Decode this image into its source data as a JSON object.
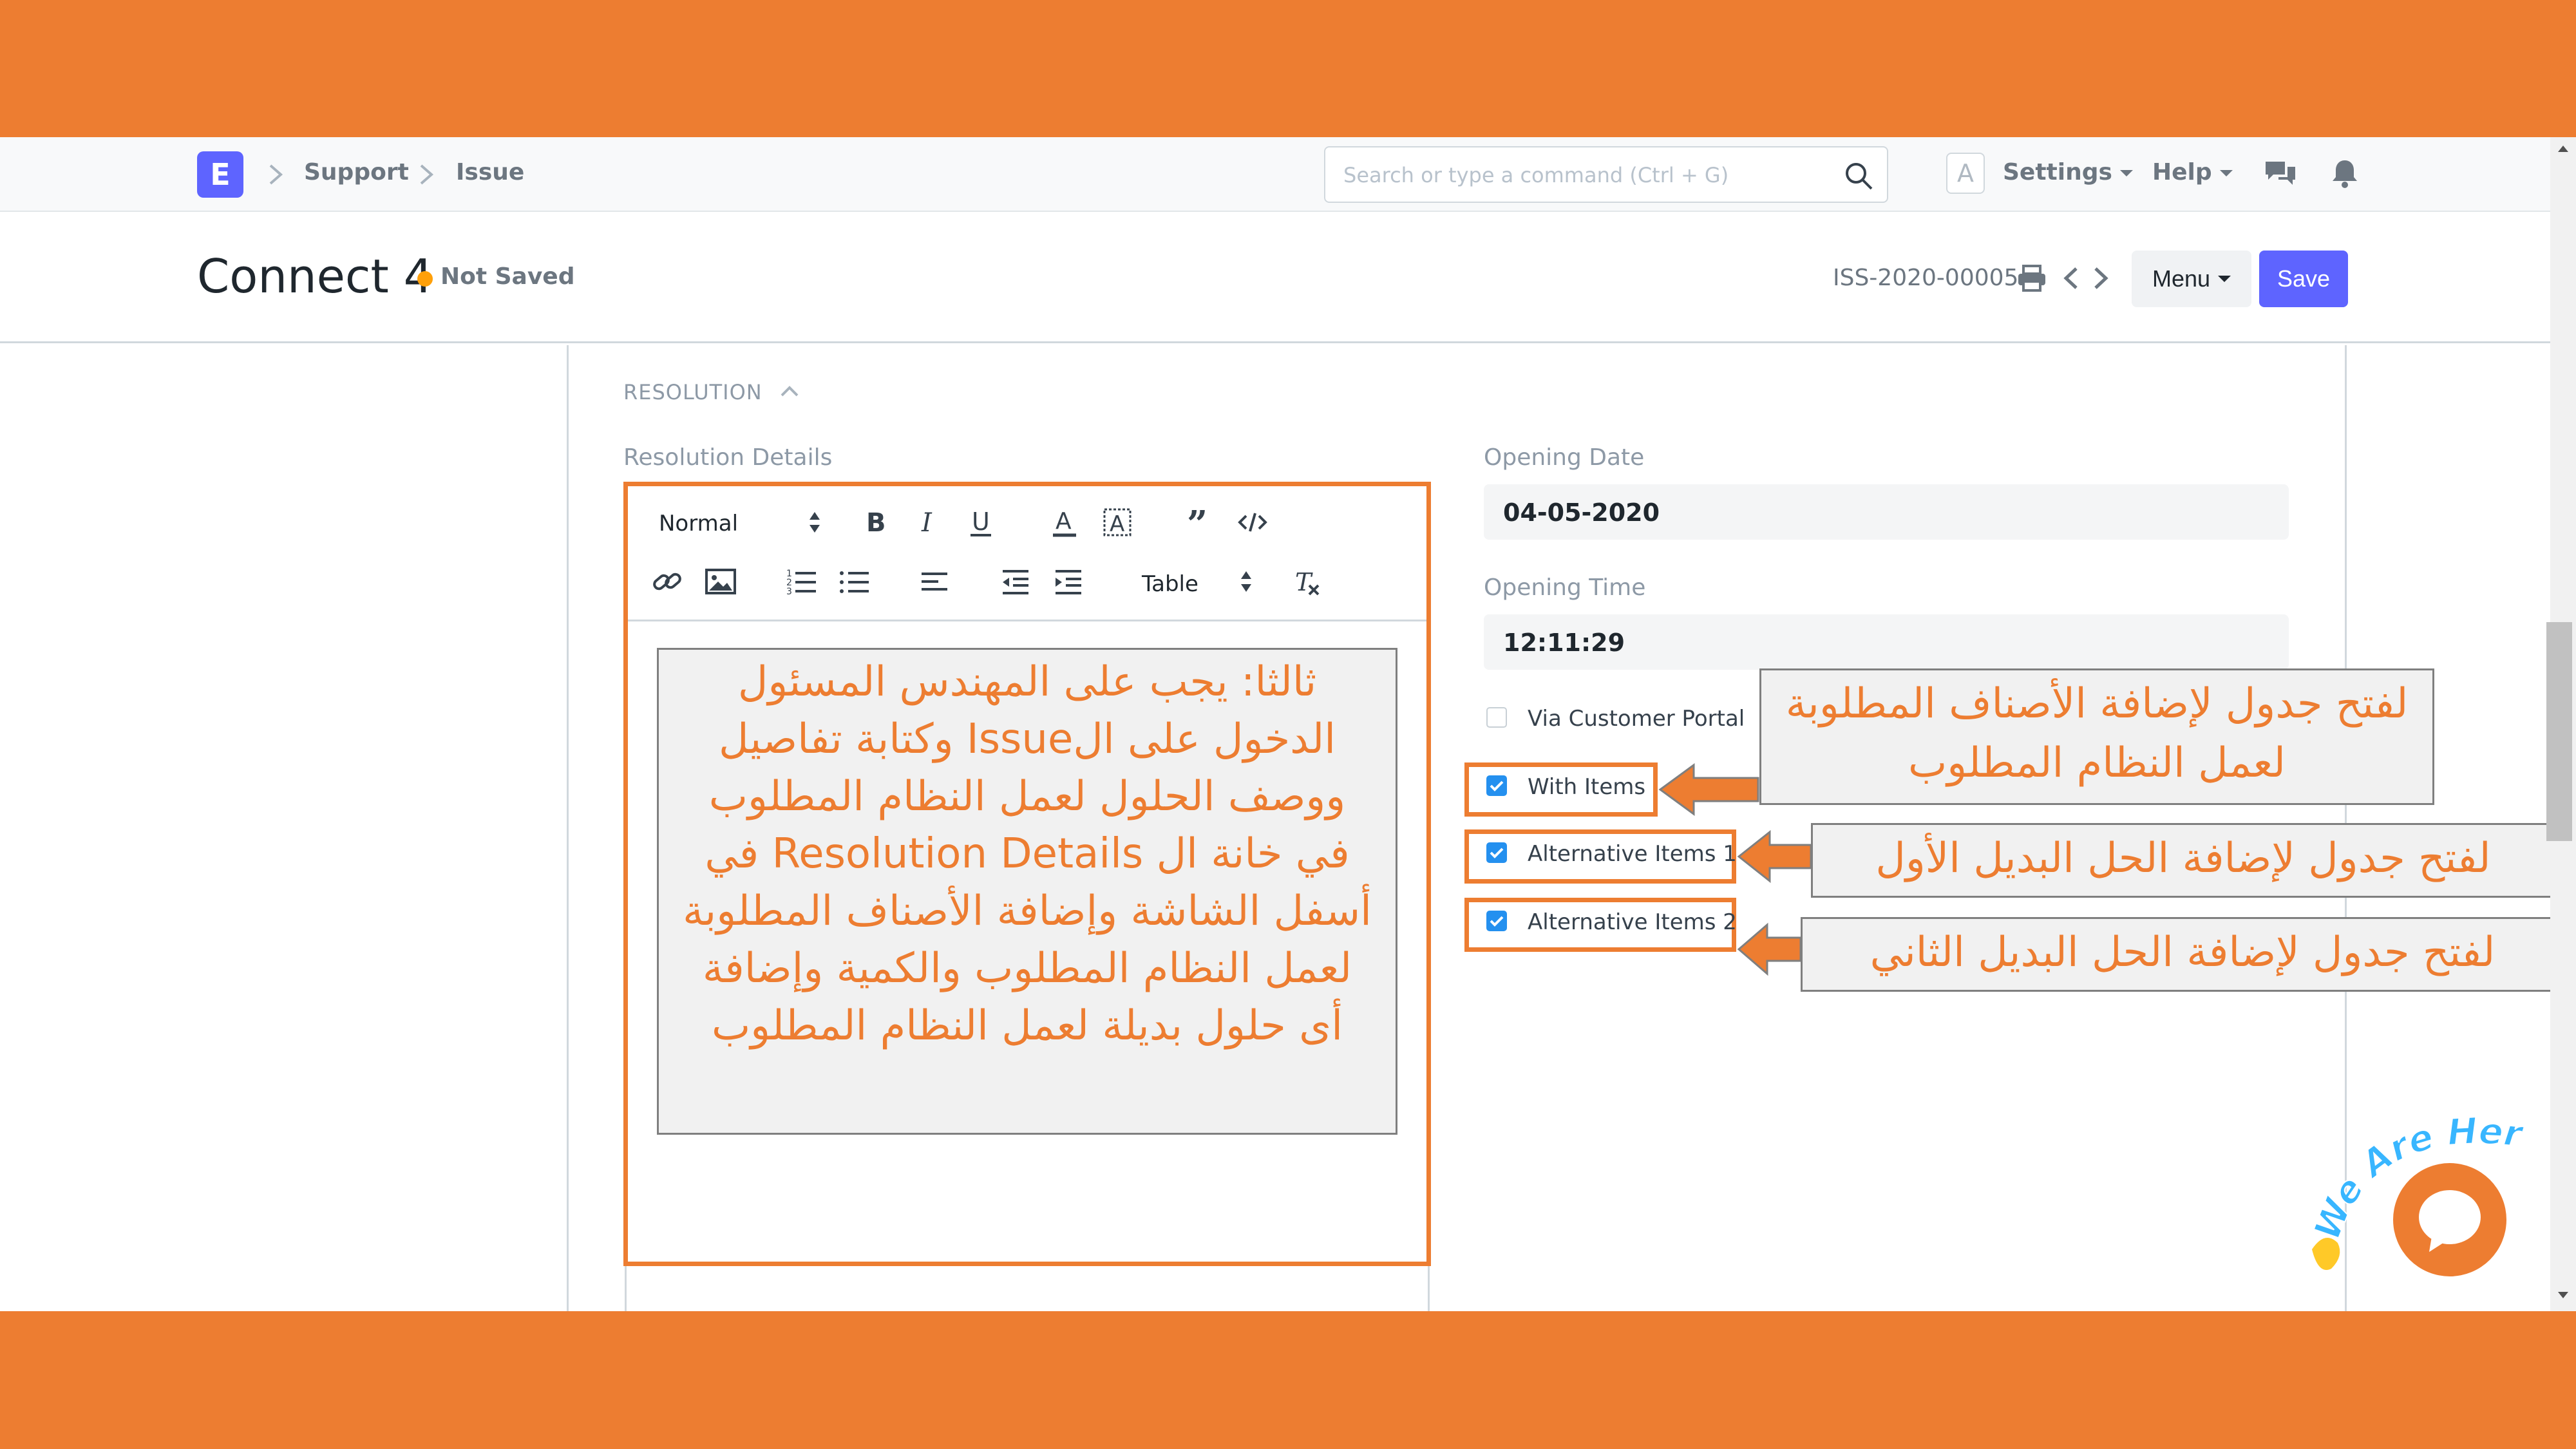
{
  "colors": {
    "accent": "#ed7d31",
    "primary": "#5e64ff",
    "checkbox": "#2490ef",
    "status_dot": "#ffa00a"
  },
  "navbar": {
    "logo": "E",
    "breadcrumbs": [
      "Support",
      "Issue"
    ],
    "search_placeholder": "Search or type a command (Ctrl + G)",
    "avatar": "A",
    "settings_label": "Settings",
    "help_label": "Help",
    "icons": [
      "search-icon",
      "chat-icon",
      "bell-icon"
    ]
  },
  "page_head": {
    "title": "Connect 4",
    "status": "Not Saved",
    "doc_id": "ISS-2020-00005",
    "menu_label": "Menu",
    "save_label": "Save"
  },
  "form": {
    "section_title": "RESOLUTION",
    "resolution_label": "Resolution Details",
    "editor_toolbar": {
      "font_size": "Normal",
      "table": "Table"
    },
    "instruction_text": "ثالثا: يجب على المهندس المسئول الدخول على الIssue وكتابة تفاصيل ووصف الحلول لعمل النظام المطلوب في خانة ال Resolution Details في أسفل الشاشة وإضافة الأصناف المطلوبة لعمل النظام المطلوب والكمية وإضافة أى حلول بديلة لعمل النظام المطلوب",
    "opening_date_label": "Opening Date",
    "opening_date": "04-05-2020",
    "opening_time_label": "Opening Time",
    "opening_time": "12:11:29",
    "checkboxes": [
      {
        "label": "Via Customer Portal",
        "checked": false
      },
      {
        "label": "With Items",
        "checked": true
      },
      {
        "label": "Alternative Items 1",
        "checked": true
      },
      {
        "label": "Alternative Items 2",
        "checked": true
      }
    ]
  },
  "callouts": {
    "with_items": "لفتح جدول لإضافة الأصناف المطلوبة لعمل النظام المطلوب",
    "alt1": "لفتح جدول لإضافة الحل البديل الأول",
    "alt2": "لفتح جدول لإضافة الحل البديل الثاني"
  },
  "chat_widget": {
    "tagline": "We Are Here!"
  }
}
